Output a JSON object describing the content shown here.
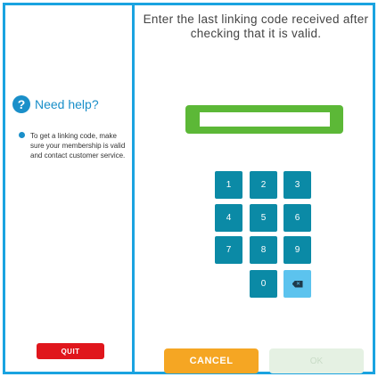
{
  "help": {
    "icon": "question-icon",
    "title": "Need help?",
    "text": "To get a linking code, make sure your membership is valid and contact customer service."
  },
  "buttons": {
    "quit": "QUIT",
    "cancel": "CANCEL",
    "ok": "OK"
  },
  "instructions": "Enter the last linking code received after checking that it is valid.",
  "code_input": {
    "value": "",
    "placeholder": ""
  },
  "keypad": {
    "keys": [
      "1",
      "2",
      "3",
      "4",
      "5",
      "6",
      "7",
      "8",
      "9",
      "0"
    ],
    "backspace_icon": "backspace-icon"
  },
  "colors": {
    "frame": "#1aa3e0",
    "quit": "#e0161c",
    "cancel": "#f5a623",
    "ok_disabled": "#e5f1e3",
    "key": "#0b8aa6",
    "backspace_key": "#5cc3ee",
    "code_frame": "#5cb837"
  }
}
